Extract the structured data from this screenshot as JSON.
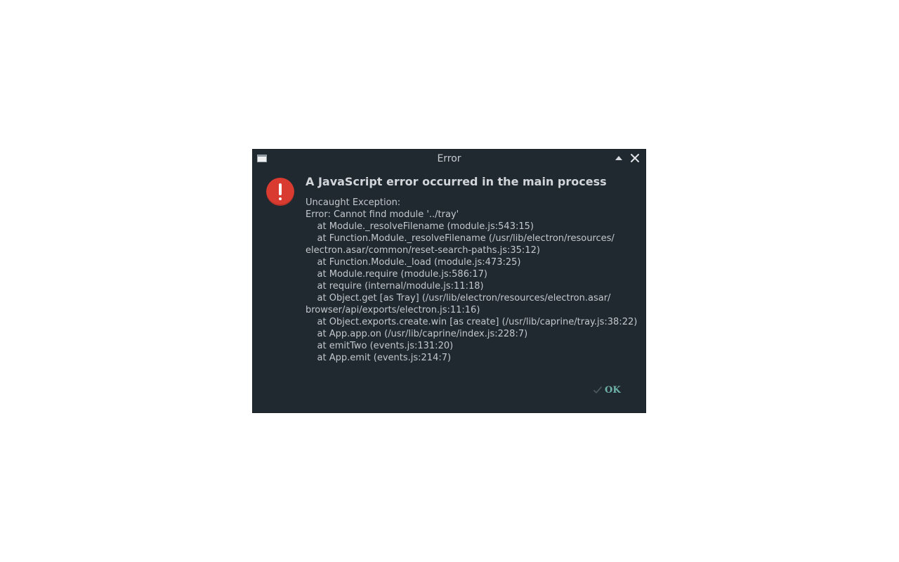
{
  "window": {
    "title": "Error"
  },
  "dialog": {
    "heading": "A JavaScript error occurred in the main process",
    "message_lines": [
      "Uncaught Exception:",
      "Error: Cannot find module '../tray'",
      "    at Module._resolveFilename (module.js:543:15)",
      "    at Function.Module._resolveFilename (/usr/lib/electron/resources/",
      "electron.asar/common/reset-search-paths.js:35:12)",
      "    at Function.Module._load (module.js:473:25)",
      "    at Module.require (module.js:586:17)",
      "    at require (internal/module.js:11:18)",
      "    at Object.get [as Tray] (/usr/lib/electron/resources/electron.asar/",
      "browser/api/exports/electron.js:11:16)",
      "    at Object.exports.create.win [as create] (/usr/lib/caprine/tray.js:38:22)",
      "    at App.app.on (/usr/lib/caprine/index.js:228:7)",
      "    at emitTwo (events.js:131:20)",
      "    at App.emit (events.js:214:7)"
    ],
    "ok_label": "OK"
  },
  "icons": {
    "window_icon": "window-icon",
    "shade": "shade-up-icon",
    "close": "close-icon",
    "error": "error-icon",
    "ok": "checkmark-icon"
  },
  "colors": {
    "dialog_bg": "#202930",
    "error_red": "#d93b30",
    "ok_accent": "#6fb3a8",
    "text": "#c3c8cd"
  }
}
